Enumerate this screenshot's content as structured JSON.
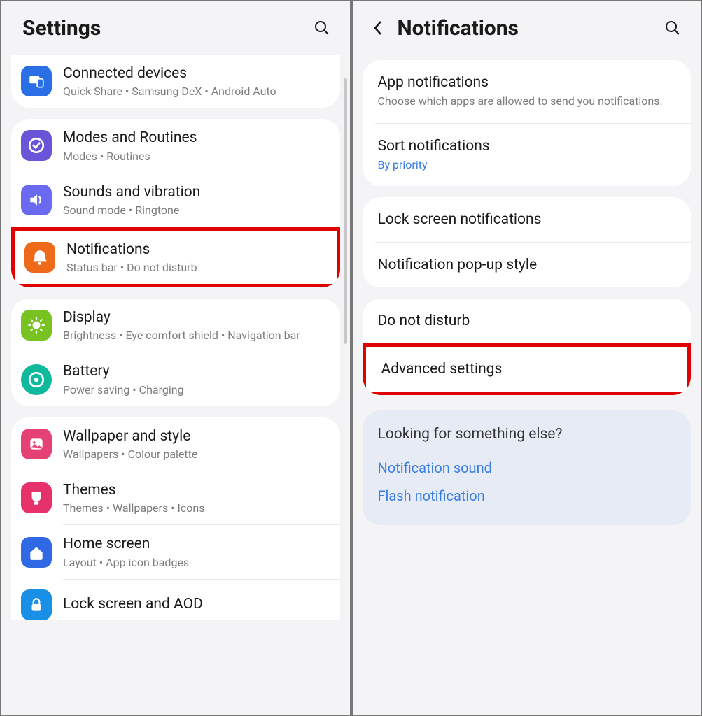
{
  "left": {
    "title": "Settings",
    "items": [
      {
        "title": "Connected devices",
        "sub": "Quick Share  •  Samsung DeX  •  Android Auto",
        "icon": "devices",
        "color": "#2b6fe6"
      },
      {
        "title": "Modes and Routines",
        "sub": "Modes  •  Routines",
        "icon": "check-circle",
        "color": "#6a55d8"
      },
      {
        "title": "Sounds and vibration",
        "sub": "Sound mode  •  Ringtone",
        "icon": "volume",
        "color": "#6a6af0"
      },
      {
        "title": "Notifications",
        "sub": "Status bar  •  Do not disturb",
        "icon": "bell",
        "color": "#ee6a1a"
      },
      {
        "title": "Display",
        "sub": "Brightness  •  Eye comfort shield  •  Navigation bar",
        "icon": "brightness",
        "color": "#78c321"
      },
      {
        "title": "Battery",
        "sub": "Power saving  •  Charging",
        "icon": "battery",
        "color": "#0fb99c"
      },
      {
        "title": "Wallpaper and style",
        "sub": "Wallpapers  •  Colour palette",
        "icon": "image",
        "color": "#e64174"
      },
      {
        "title": "Themes",
        "sub": "Themes  •  Wallpapers  •  Icons",
        "icon": "theme",
        "color": "#e6316a"
      },
      {
        "title": "Home screen",
        "sub": "Layout  •  App icon badges",
        "icon": "home",
        "color": "#2f69e6"
      },
      {
        "title": "Lock screen and AOD",
        "sub": "",
        "icon": "lock",
        "color": "#1a8fe6"
      }
    ]
  },
  "right": {
    "title": "Notifications",
    "group1": {
      "app_notifications": {
        "title": "App notifications",
        "sub": "Choose which apps are allowed to send you notifications."
      },
      "sort": {
        "title": "Sort notifications",
        "sub": "By priority"
      }
    },
    "group2": {
      "lock": "Lock screen notifications",
      "popup": "Notification pop-up style"
    },
    "group3": {
      "dnd": "Do not disturb",
      "advanced": "Advanced settings"
    },
    "hint": {
      "title": "Looking for something else?",
      "links": [
        "Notification sound",
        "Flash notification"
      ]
    }
  }
}
